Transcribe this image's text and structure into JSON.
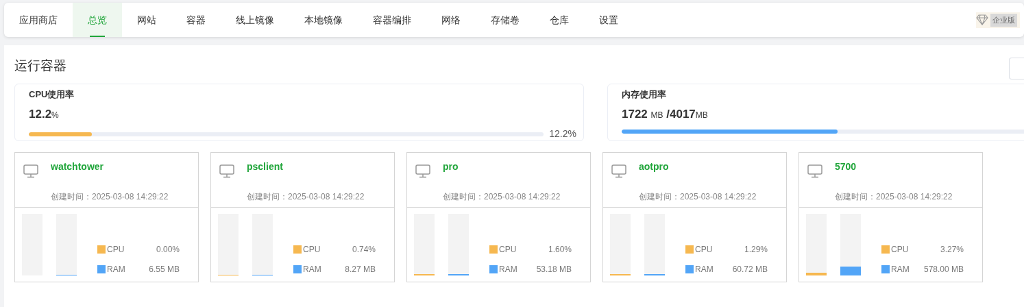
{
  "tabs": [
    {
      "label": "应用商店",
      "selected": false
    },
    {
      "label": "总览",
      "selected": true
    },
    {
      "label": "网站",
      "selected": false
    },
    {
      "label": "容器",
      "selected": false
    },
    {
      "label": "线上镜像",
      "selected": false
    },
    {
      "label": "本地镜像",
      "selected": false
    },
    {
      "label": "容器编排",
      "selected": false
    },
    {
      "label": "网络",
      "selected": false
    },
    {
      "label": "存储卷",
      "selected": false
    },
    {
      "label": "仓库",
      "selected": false
    },
    {
      "label": "设置",
      "selected": false
    }
  ],
  "edition_badge": "企业版",
  "section_title": "运行容器",
  "cpu_usage": {
    "title": "CPU使用率",
    "value": "12.2",
    "unit": "%",
    "level": 0.122,
    "reading": "12.2%"
  },
  "memory_usage": {
    "title": "内存使用率",
    "used": "1722",
    "used_unit": "MB",
    "total": "/4017",
    "total_unit": "MB",
    "level": 0.429
  },
  "containers": [
    {
      "name": "watchtower",
      "created": "创建时间：2025-03-08 14:29:22",
      "cpu_bar": {
        "level": 0
      },
      "ram_bar": {
        "level": 0.01
      },
      "cpu_label": "CPU",
      "cpu": "0.00%",
      "ram_label": "RAM",
      "ram": "6.55 MB"
    },
    {
      "name": "psclient",
      "created": "创建时间：2025-03-08 14:29:22",
      "cpu_bar": {
        "level": 0.01
      },
      "ram_bar": {
        "level": 0.01
      },
      "cpu_label": "CPU",
      "cpu": "0.74%",
      "ram_label": "RAM",
      "ram": "8.27 MB"
    },
    {
      "name": "pro",
      "created": "创建时间：2025-03-08 14:29:22",
      "cpu_bar": {
        "level": 0.02
      },
      "ram_bar": {
        "level": 0.02
      },
      "cpu_label": "CPU",
      "cpu": "1.60%",
      "ram_label": "RAM",
      "ram": "53.18 MB"
    },
    {
      "name": "aotpro",
      "created": "创建时间：2025-03-08 14:29:22",
      "cpu_bar": {
        "level": 0.02
      },
      "ram_bar": {
        "level": 0.02
      },
      "cpu_label": "CPU",
      "cpu": "1.29%",
      "ram_label": "RAM",
      "ram": "60.72 MB"
    },
    {
      "name": "5700",
      "created": "创建时间：2025-03-08 14:29:22",
      "cpu_bar": {
        "level": 0.04
      },
      "ram_bar": {
        "level": 0.14
      },
      "cpu_label": "CPU",
      "cpu": "3.27%",
      "ram_label": "RAM",
      "ram": "578.00 MB"
    }
  ]
}
